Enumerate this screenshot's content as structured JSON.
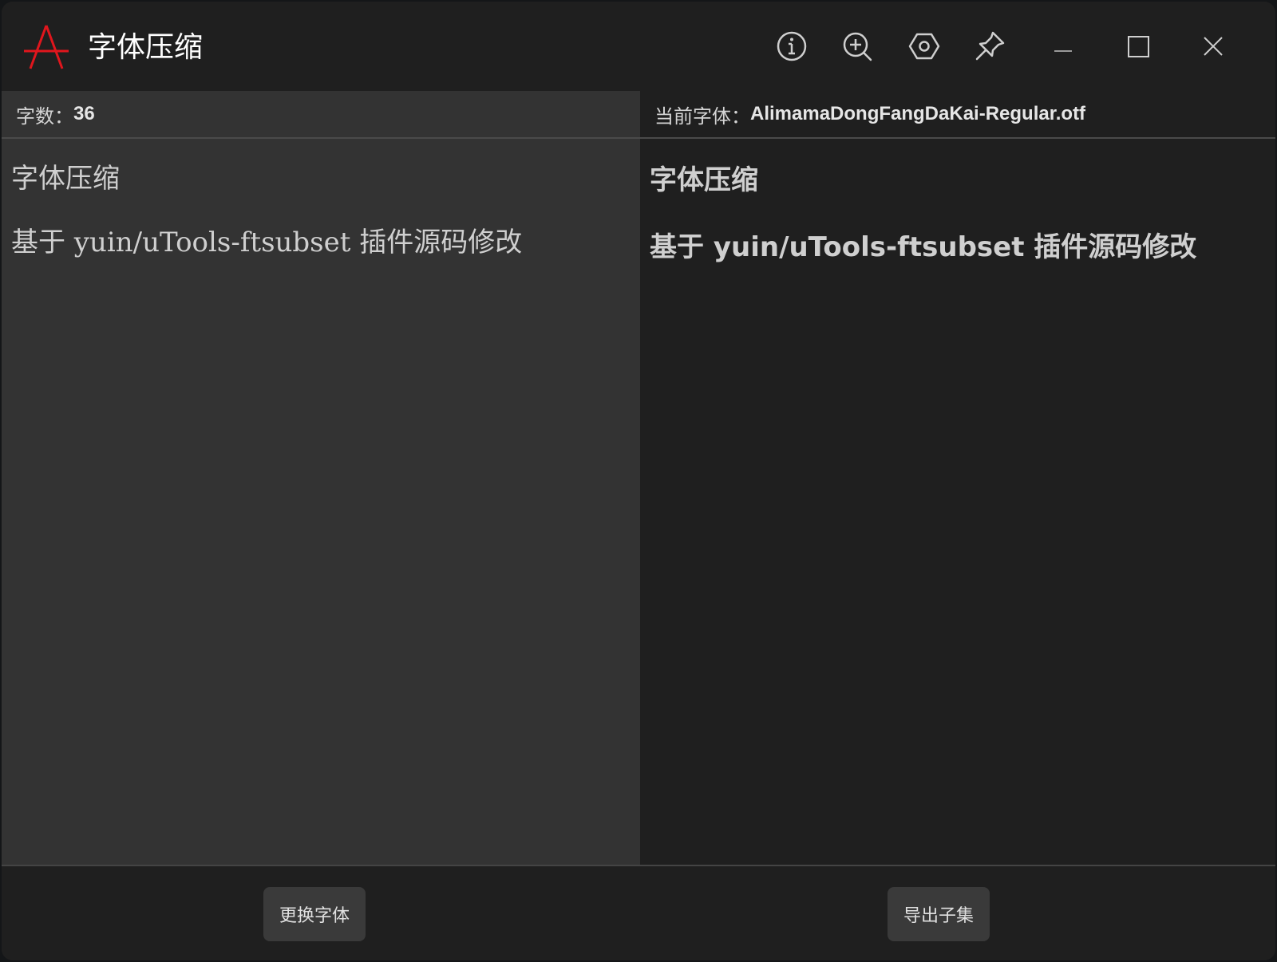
{
  "window": {
    "title": "字体压缩"
  },
  "titlebar": {
    "icons": [
      "info-icon",
      "zoom-in-icon",
      "settings-icon",
      "pin-icon",
      "minimize-icon",
      "maximize-icon",
      "close-icon"
    ]
  },
  "left_panel": {
    "count_label": "字数：",
    "count_value": "36",
    "input_text": "字体压缩\n基于 yuin/uTools-ftsubset 插件源码修改"
  },
  "right_panel": {
    "font_label": "当前字体：",
    "font_name": "AlimamaDongFangDaKai-Regular.otf",
    "preview_lines": [
      "字体压缩",
      "基于 yuin/uTools-ftsubset 插件源码修改"
    ]
  },
  "footer": {
    "change_font_label": "更换字体",
    "export_subset_label": "导出子集"
  },
  "colors": {
    "logo_accent": "#e0161d",
    "window_bg": "#1f1f1f",
    "input_panel_bg": "#333333"
  }
}
